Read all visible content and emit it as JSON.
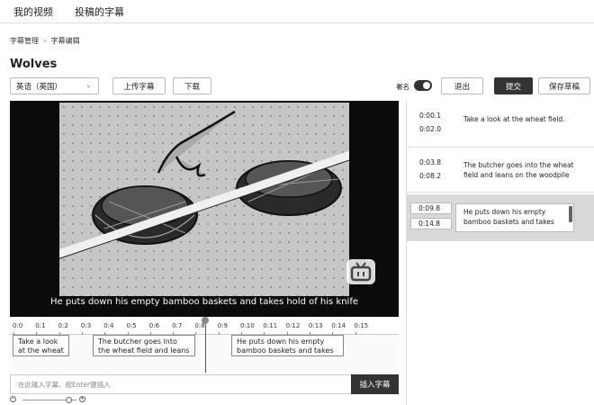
{
  "nav": {
    "tabs": [
      "我的视频",
      "投稿的字幕"
    ]
  },
  "breadcrumb": {
    "parent": "字幕管理",
    "current": "字幕编辑"
  },
  "page_title": "Wolves",
  "toolbar": {
    "language_select": "英语（英国）",
    "upload_label": "上传字幕",
    "download_label": "下载",
    "sign_label": "署名",
    "sign_on": true,
    "exit_label": "退出",
    "submit_label": "提交",
    "save_draft_label": "保存草稿"
  },
  "player": {
    "subtitle": "He puts down his empty bamboo baskets and takes hold of his knife",
    "logo_icon": "tv-logo-icon"
  },
  "timeline": {
    "ticks": [
      "0:0",
      "0:1",
      "0:2",
      "0:3",
      "0:4",
      "0:5",
      "0:6",
      "0:7",
      "0:8",
      "0:9",
      "0:10",
      "0:11",
      "0:12",
      "0:13",
      "0:14",
      "0:15"
    ],
    "cues": [
      {
        "text": "Take a look at the wheat"
      },
      {
        "text": "The butcher goes into the wheat field and leans on the"
      },
      {
        "text": "He puts down his empty bamboo baskets and takes"
      }
    ],
    "input_placeholder": "在此输入字幕，按Enter键插入",
    "insert_label": "插入字幕",
    "zoom_level": 0.85
  },
  "subtitle_list": [
    {
      "start": "0:00.1",
      "end": "0:02.0",
      "text": "Take a look at the wheat field."
    },
    {
      "start": "0:03.8",
      "end": "0:08.2",
      "text": "The butcher goes into the wheat field and leans on the woodpile"
    },
    {
      "start": "0:09.8",
      "end": "0:14.8",
      "text": "He puts down his empty bamboo baskets and takes"
    }
  ],
  "colors": {
    "accent": "#333333",
    "active_row": "#d9d9d9"
  }
}
